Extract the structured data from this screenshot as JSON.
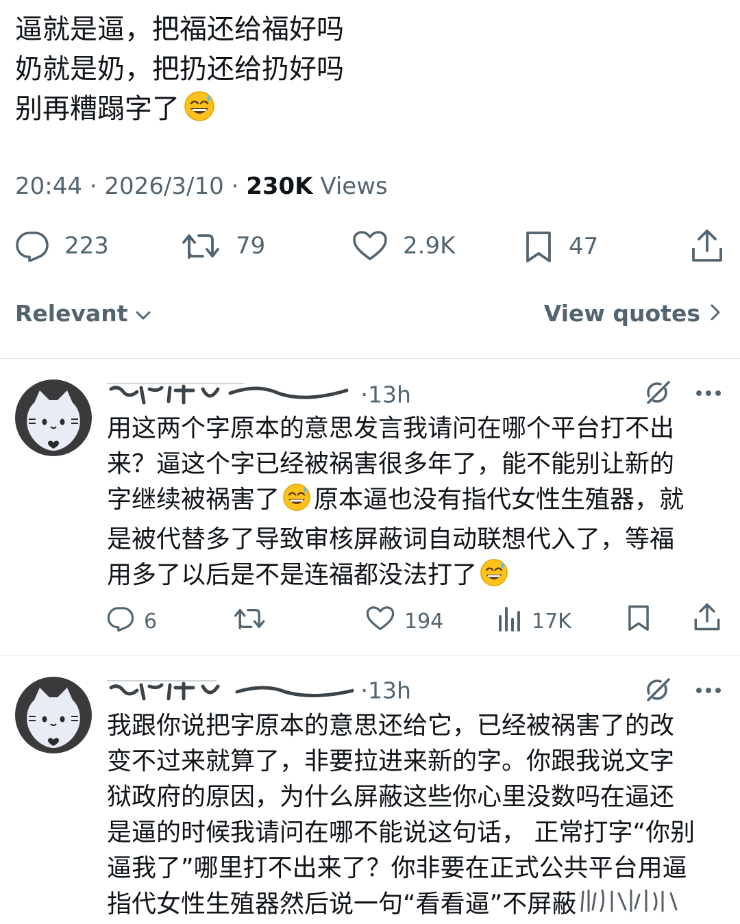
{
  "tweet": {
    "lines": [
      "逼就是逼，把福还给福好吗",
      "奶就是奶，把扔还给扔好吗",
      "别再糟蹋字了"
    ],
    "time": "20:44",
    "date": "2026/3/10",
    "views_count": "230K",
    "views_label": "Views",
    "sep": "·"
  },
  "actions": {
    "replies": "223",
    "retweets": "79",
    "likes": "2.9K",
    "bookmarks": "47"
  },
  "sort": {
    "relevant_label": "Relevant",
    "view_quotes_label": "View quotes"
  },
  "replies": [
    {
      "time": "13h",
      "lines": [
        "用这两个字原本的意思发言我请问在哪个平台打不出",
        "来？逼这个字已经被祸害很多年了，能不能别让新的",
        "字继续被祸害了",
        "原本逼也没有指代女性生殖器，就",
        "是被代替多了导致审核屏蔽词自动联想代入了，等福",
        "用多了以后是不是连福都没法打了"
      ],
      "replies": "6",
      "likes": "194",
      "views": "17K"
    },
    {
      "time": "13h",
      "lines": [
        "我跟你说把字原本的意思还给它，已经被祸害了的改",
        "变不过来就算了，非要拉进来新的字。你跟我说文字",
        "狱政府的原因，为什么屏蔽这些你心里没数吗在逼还",
        "是逼的时候我请问在哪不能说这句话， 正常打字“你别",
        "逼我了”哪里打不出来了？你非要在正式公共平台用逼",
        "指代女性生殖器然后说一句“看看逼”不屏蔽"
      ]
    }
  ],
  "icons": {
    "reply": "reply-icon",
    "retweet": "retweet-icon",
    "like": "heart-icon",
    "bookmark": "bookmark-icon",
    "share": "share-icon",
    "views": "views-icon",
    "grok": "grok-icon",
    "more": "more-icon",
    "emoji": "sweat-smile-emoji",
    "avatar": "cat-avatar"
  },
  "colors": {
    "text": "#0f1419",
    "secondary": "#536471",
    "divider": "#dfe3e6",
    "avatar_bg": "#3a3a3c"
  }
}
